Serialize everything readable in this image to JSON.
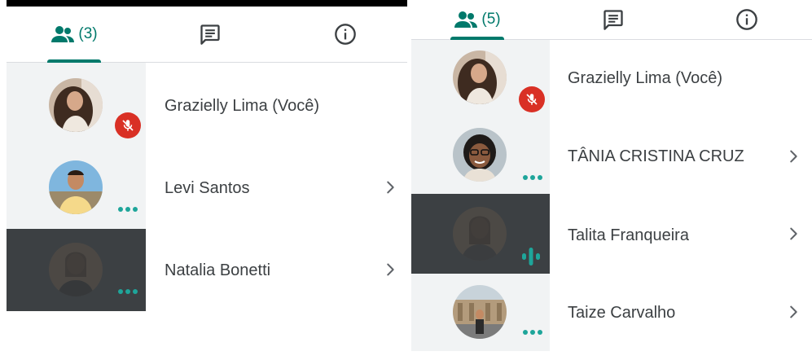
{
  "colors": {
    "accent": "#00796b",
    "activity": "#1ea59a",
    "muted_red": "#d93025",
    "tile_bg": "#f1f3f4",
    "tile_dark": "#3c4043"
  },
  "left_panel": {
    "tabs": {
      "people": {
        "icon": "people-icon",
        "count": "(3)"
      },
      "chat": {
        "icon": "chat-icon"
      },
      "info": {
        "icon": "info-icon"
      }
    },
    "participants": [
      {
        "name": "Grazielly Lima (Você)",
        "status": "mic-off-icon",
        "chevron": false
      },
      {
        "name": "Levi Santos",
        "status": "activity-dots-icon",
        "chevron": true
      },
      {
        "name": "Natalia Bonetti",
        "status": "activity-dots-icon",
        "chevron": true
      }
    ]
  },
  "right_panel": {
    "tabs": {
      "people": {
        "icon": "people-icon",
        "count": "(5)"
      },
      "chat": {
        "icon": "chat-icon"
      },
      "info": {
        "icon": "info-icon"
      }
    },
    "participants": [
      {
        "name": "Grazielly Lima (Você)",
        "status": "mic-off-icon",
        "chevron": false
      },
      {
        "name": "TÂNIA CRISTINA CRUZ",
        "status": "activity-dots-icon",
        "chevron": true
      },
      {
        "name": "Talita Franqueira",
        "status": "speaking-icon",
        "chevron": true
      },
      {
        "name": "Taize Carvalho",
        "status": "activity-dots-icon",
        "chevron": true
      }
    ]
  }
}
